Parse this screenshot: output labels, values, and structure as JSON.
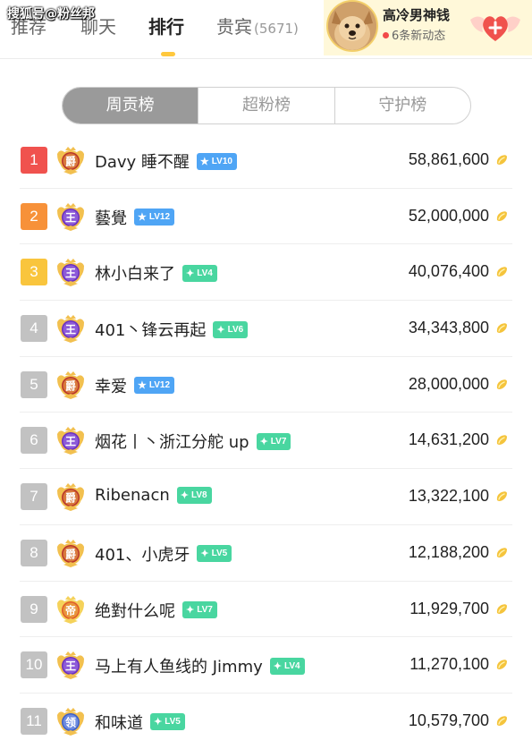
{
  "watermark": "搜狐号@粉丝邦",
  "tabs": [
    {
      "label": "推荐"
    },
    {
      "label": "聊天"
    },
    {
      "label": "排行"
    },
    {
      "label": "贵宾",
      "count": "(5671)"
    }
  ],
  "host": {
    "name": "高冷男神钱",
    "dynamic_count": "6",
    "dynamic_text": "条新动态"
  },
  "segments": [
    "周贡榜",
    "超粉榜",
    "守护榜"
  ],
  "colors": {
    "rank1": "#f0524e",
    "rank2": "#f79139",
    "rank3": "#f9c53d",
    "rank_other": "#c2c2c2",
    "level_blue": "#4fa5f5",
    "level_green": "#49d6a0",
    "accent": "#ffc83d"
  },
  "ranking": [
    {
      "rank": "1",
      "name": "Davy 睡不醒",
      "badge": "爵",
      "badge_icon": "noble-badge-gold-icon",
      "level": "LV10",
      "level_color": "blue",
      "score": "58,861,600"
    },
    {
      "rank": "2",
      "name": "藝覺",
      "badge": "王",
      "badge_icon": "king-badge-purple-icon",
      "level": "LV12",
      "level_color": "blue",
      "score": "52,000,000"
    },
    {
      "rank": "3",
      "name": "林小白来了",
      "badge": "王",
      "badge_icon": "king-badge-purple-icon",
      "level": "LV4",
      "level_color": "green",
      "score": "40,076,400"
    },
    {
      "rank": "4",
      "name": "401丶锋云再起",
      "badge": "王",
      "badge_icon": "king-badge-purple-icon",
      "level": "LV6",
      "level_color": "green",
      "score": "34,343,800"
    },
    {
      "rank": "5",
      "name": "幸爱",
      "badge": "爵",
      "badge_icon": "noble-badge-gold-icon",
      "level": "LV12",
      "level_color": "blue",
      "score": "28,000,000"
    },
    {
      "rank": "6",
      "name": "烟花丨丶浙江分舵 up",
      "badge": "王",
      "badge_icon": "king-badge-purple-icon",
      "level": "LV7",
      "level_color": "green",
      "score": "14,631,200"
    },
    {
      "rank": "7",
      "name": "Ribenacn",
      "badge": "爵",
      "badge_icon": "noble-badge-gold-icon",
      "level": "LV8",
      "level_color": "green",
      "score": "13,322,100"
    },
    {
      "rank": "8",
      "name": "401、小虎牙",
      "badge": "爵",
      "badge_icon": "noble-badge-gold-icon",
      "level": "LV5",
      "level_color": "green",
      "score": "12,188,200"
    },
    {
      "rank": "9",
      "name": "绝對什么呢",
      "badge": "帝",
      "badge_icon": "emperor-badge-orange-icon",
      "level": "LV7",
      "level_color": "green",
      "score": "11,929,700"
    },
    {
      "rank": "10",
      "name": "马上有人鱼线的 Jimmy",
      "badge": "王",
      "badge_icon": "king-badge-purple-icon",
      "level": "LV4",
      "level_color": "green",
      "score": "11,270,100"
    },
    {
      "rank": "11",
      "name": "和味道",
      "badge": "领",
      "badge_icon": "lord-badge-blue-icon",
      "level": "LV5",
      "level_color": "green",
      "score": "10,579,700"
    }
  ]
}
